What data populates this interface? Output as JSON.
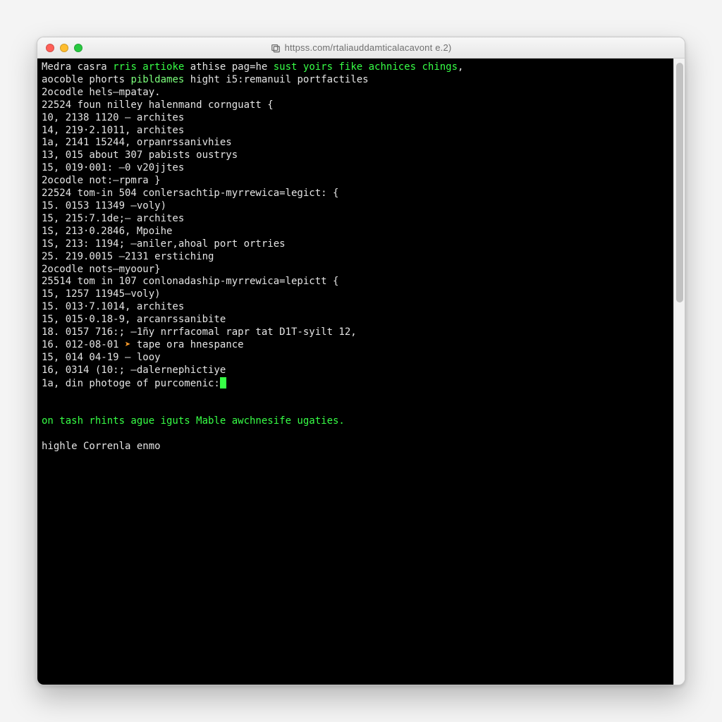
{
  "window": {
    "title_prefix_icon": "tabs-icon",
    "title": "httpss.com/rtaliauddamticalacavont e.2)"
  },
  "terminal": {
    "lines": [
      {
        "segments": [
          {
            "t": "Medra casra ",
            "cls": "w"
          },
          {
            "t": "rris artioke",
            "cls": "g"
          },
          {
            "t": " athise pag=he ",
            "cls": "w"
          },
          {
            "t": "sust yoirs fike achnices chings",
            "cls": "g"
          },
          {
            "t": ",",
            "cls": "w"
          }
        ]
      },
      {
        "segments": [
          {
            "t": "aocoble phorts ",
            "cls": "w"
          },
          {
            "t": "pibldames",
            "cls": "g2"
          },
          {
            "t": " hight i5:",
            "cls": "w"
          },
          {
            "t": "remanuil portfactiles",
            "cls": "w"
          }
        ]
      },
      {
        "segments": [
          {
            "t": "2ocodle hels—mpatay.",
            "cls": "w"
          }
        ]
      },
      {
        "segments": [
          {
            "t": "22524 foun nilley halenmand cornguatt {",
            "cls": "w"
          }
        ]
      },
      {
        "segments": [
          {
            "t": "10, 2138 1120 — archites",
            "cls": "w"
          }
        ]
      },
      {
        "segments": [
          {
            "t": "14, 219·2.1011, archites",
            "cls": "w"
          }
        ]
      },
      {
        "segments": [
          {
            "t": "1a, 2141 15244, orpanrssanivhies",
            "cls": "w"
          }
        ]
      },
      {
        "segments": [
          {
            "t": "13, 015 about 307 pabists oustrys",
            "cls": "w"
          }
        ]
      },
      {
        "segments": [
          {
            "t": "15, 019·001: –0 v20jjtes",
            "cls": "w"
          }
        ]
      },
      {
        "segments": [
          {
            "t": "2ocodle not:—rpmra }",
            "cls": "w"
          }
        ]
      },
      {
        "segments": [
          {
            "t": "22524 tom-in 504 conlersachtip-myrrewica=legict: {",
            "cls": "w"
          }
        ]
      },
      {
        "segments": [
          {
            "t": "15. 0153 11349 –voly)",
            "cls": "w"
          }
        ]
      },
      {
        "segments": [
          {
            "t": "15, 215:7.1de;– archites",
            "cls": "w"
          }
        ]
      },
      {
        "segments": [
          {
            "t": "1S, 213·0.2846, Mpoihe",
            "cls": "w"
          }
        ]
      },
      {
        "segments": [
          {
            "t": "1S, 213: 1194; –aniler,ahoal port ortries",
            "cls": "w"
          }
        ]
      },
      {
        "segments": [
          {
            "t": "25. 219.0015 –2131 erstiching",
            "cls": "w"
          }
        ]
      },
      {
        "segments": [
          {
            "t": "2ocodle nots—myoour}",
            "cls": "w"
          }
        ]
      },
      {
        "segments": [
          {
            "t": "25514 tom in 107 conlonadaship-myrrewica=lepictt {",
            "cls": "w"
          }
        ]
      },
      {
        "segments": [
          {
            "t": "15, 1257 11945—voly)",
            "cls": "w"
          }
        ]
      },
      {
        "segments": [
          {
            "t": "15. 013·7.1014, archites",
            "cls": "w"
          }
        ]
      },
      {
        "segments": [
          {
            "t": "15, 015·0.18-9, arcanrssanibite",
            "cls": "w"
          }
        ]
      },
      {
        "segments": [
          {
            "t": "18. 0157 716:; –1ñy nrrfacomal rapr tat D1T-syilt 12,",
            "cls": "w"
          }
        ]
      },
      {
        "segments": [
          {
            "t": "16. 012-08-01 ",
            "cls": "w"
          },
          {
            "t": "➤",
            "cls": "o"
          },
          {
            "t": " tape ora hnespance",
            "cls": "w"
          }
        ]
      },
      {
        "segments": [
          {
            "t": "15, 014 04-19 – looy",
            "cls": "w"
          }
        ]
      },
      {
        "segments": [
          {
            "t": "16, 0314 (10:; –dalernephictiye",
            "cls": "w"
          }
        ]
      },
      {
        "segments": [
          {
            "t": "1a, din photoge of purcomenic:",
            "cls": "w"
          },
          {
            "t": "",
            "cls": "cursor-slot"
          }
        ]
      },
      {
        "segments": [
          {
            "t": "",
            "cls": "w"
          }
        ]
      },
      {
        "segments": [
          {
            "t": "",
            "cls": "w"
          }
        ]
      },
      {
        "segments": [
          {
            "t": "on tash rhints ague iguts Mable awchnesife ugaties.",
            "cls": "g"
          }
        ]
      },
      {
        "segments": [
          {
            "t": "",
            "cls": "w"
          }
        ]
      },
      {
        "segments": [
          {
            "t": "highle Correnla enmo",
            "cls": "w"
          }
        ]
      }
    ]
  }
}
